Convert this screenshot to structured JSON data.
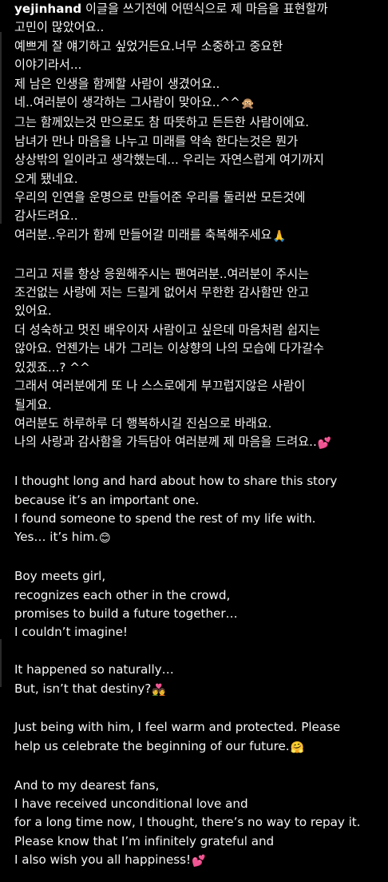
{
  "post": {
    "username": "yejinhand",
    "korean": [
      [
        "이글을 쓰기전에 어떤식으로 제 마음을 표현할까"
      ],
      [
        "고민이 많았어요.."
      ],
      [
        "예쁘게 잘 얘기하고 싶었거든요.너무 소중하고 중요한"
      ],
      [
        "이야기라서..."
      ],
      [
        "제 남은 인생을 함께할 사람이 생겼어요.."
      ],
      [
        "네..여러분이 생각하는 그사람이 맞아요..^^",
        "🙊"
      ],
      [
        "그는 함께있는것 만으로도 참 따뜻하고 든든한 사람이에요."
      ],
      [
        "남녀가 만나 마음을 나누고 미래를 약속 한다는것은  뭔가"
      ],
      [
        "상상밖의 일이라고 생각했는데... 우리는 자연스럽게 여기까지"
      ],
      [
        "오게 됐네요."
      ],
      [
        "우리의 인연을 운명으로 만들어준 우리를 둘러싼 모든것에"
      ],
      [
        "감사드려요.."
      ],
      [
        "여러분..우리가 함께 만들어갈 미래를 축복해주세요",
        "🙏"
      ]
    ],
    "korean_fans": [
      [
        "그리고 저를 항상 응원해주시는 팬여러분..여러분이 주시는"
      ],
      [
        "조건없는 사랑에 저는 드릴게 없어서 무한한 감사함만 안고"
      ],
      [
        "있어요."
      ],
      [
        "더 성숙하고 멋진 배우이자 사람이고 싶은데 마음처럼 쉽지는"
      ],
      [
        "않아요. 언젠가는 내가 그리는 이상향의 나의 모습에 다가갈수"
      ],
      [
        "있겠죠...? ^^"
      ],
      [
        "그래서 여러분에게 또 나 스스로에게 부끄럽지않은 사람이"
      ],
      [
        "될게요."
      ],
      [
        "여러분도 하루하루 더 행복하시길 진심으로 바래요."
      ],
      [
        "나의 사랑과 감사함을 가득담아 여러분께 제 마음을 드려요..",
        "💕"
      ]
    ],
    "english": [
      [
        [
          "I thought long and hard about how to share this story"
        ],
        [
          "because it’s an important one."
        ],
        [
          "I found someone to spend the rest of my life with."
        ],
        [
          "Yes… it’s him.",
          "😊"
        ]
      ],
      [
        [
          "Boy meets girl,"
        ],
        [
          "recognizes each other in the crowd,"
        ],
        [
          "promises to build a future together…"
        ],
        [
          "I couldn’t imagine!"
        ]
      ],
      [
        [
          "It happened so naturally…"
        ],
        [
          "But, isn’t that destiny?",
          "💑"
        ]
      ],
      [
        [
          "Just being with him, I feel warm and protected. Please"
        ],
        [
          "help us celebrate the beginning of our future.",
          "🤗"
        ]
      ],
      [
        [
          "And to my dearest fans,"
        ],
        [
          "I have received unconditional love and"
        ],
        [
          "for a long time now, I thought, there’s no way to repay it."
        ],
        [
          "Please know that I’m infinitely grateful and"
        ],
        [
          "I also wish you all happiness!",
          "💕"
        ]
      ]
    ]
  },
  "icons": {
    "monkey": "see-no-evil-monkey-icon",
    "pray": "folded-hands-icon",
    "hearts": "two-hearts-icon",
    "smile": "smiling-face-icon",
    "couple": "couple-icon",
    "hug": "hugging-face-icon"
  },
  "colors": {
    "background": "#000000",
    "text": "#f5f5f5"
  }
}
